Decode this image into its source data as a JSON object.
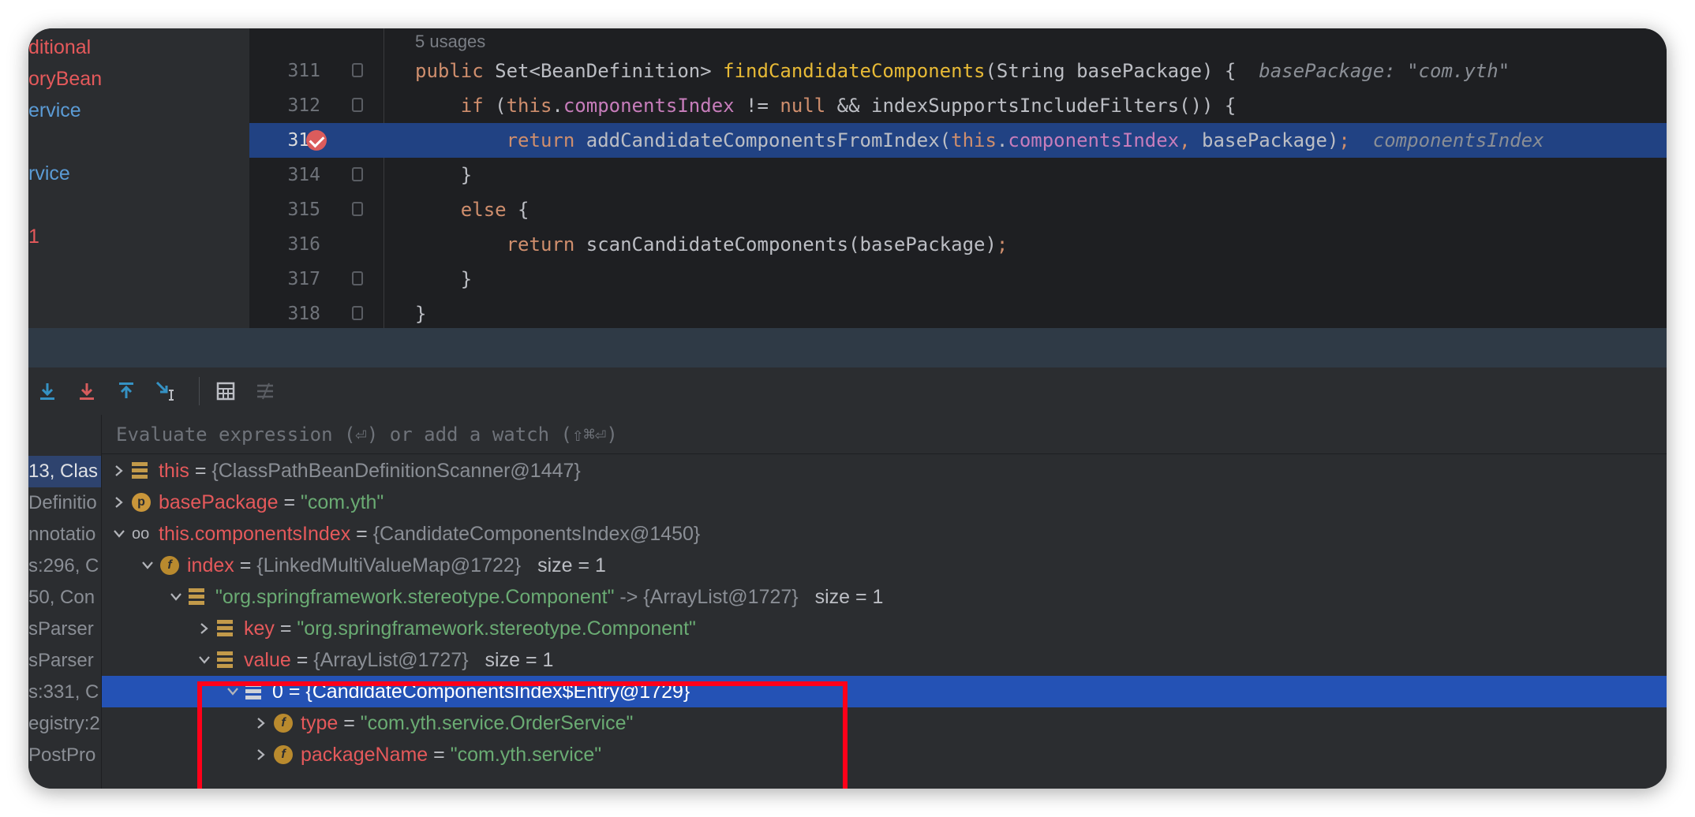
{
  "project_panel": {
    "items": [
      {
        "label": "ditional",
        "color": "red"
      },
      {
        "label": "oryBean",
        "color": "red"
      },
      {
        "label": "ervice",
        "color": "blue"
      },
      {
        "label": "rvice",
        "color": "blue"
      },
      {
        "label": "1",
        "color": "red"
      }
    ]
  },
  "editor": {
    "usages": "5 usages",
    "lines": [
      {
        "no": "311",
        "segments": [
          {
            "t": "public ",
            "c": "kw"
          },
          {
            "t": "Set<BeanDefinition> ",
            "c": ""
          },
          {
            "t": "findCandidateComponents",
            "c": "fnd"
          },
          {
            "t": "(String basePackage) {  ",
            "c": ""
          },
          {
            "t": "basePackage: \"com.yth\"",
            "c": "hint"
          }
        ]
      },
      {
        "no": "312",
        "segments": [
          {
            "t": "    if ",
            "c": "kw"
          },
          {
            "t": "(",
            "c": ""
          },
          {
            "t": "this",
            "c": "kw"
          },
          {
            "t": ".",
            "c": ""
          },
          {
            "t": "componentsIndex",
            "c": "fld"
          },
          {
            "t": " != ",
            "c": ""
          },
          {
            "t": "null",
            "c": "kw"
          },
          {
            "t": " && indexSupportsIncludeFilters()) {",
            "c": ""
          }
        ]
      },
      {
        "no": "313",
        "segments": [
          {
            "t": "        return ",
            "c": "kw"
          },
          {
            "t": "addCandidateComponentsFromIndex(",
            "c": ""
          },
          {
            "t": "this",
            "c": "kw"
          },
          {
            "t": ".",
            "c": ""
          },
          {
            "t": "componentsIndex",
            "c": "fld"
          },
          {
            "t": ", ",
            "c": "kw"
          },
          {
            "t": "basePackage)",
            "c": ""
          },
          {
            "t": ";",
            "c": "kw"
          },
          {
            "t": "  componentsIndex",
            "c": "hint"
          }
        ]
      },
      {
        "no": "314",
        "segments": [
          {
            "t": "    }",
            "c": ""
          }
        ]
      },
      {
        "no": "315",
        "segments": [
          {
            "t": "    else ",
            "c": "kw"
          },
          {
            "t": "{",
            "c": ""
          }
        ]
      },
      {
        "no": "316",
        "segments": [
          {
            "t": "        return ",
            "c": "kw"
          },
          {
            "t": "scanCandidateComponents(basePackage)",
            "c": ""
          },
          {
            "t": ";",
            "c": "kw"
          }
        ]
      },
      {
        "no": "317",
        "segments": [
          {
            "t": "    }",
            "c": ""
          }
        ]
      },
      {
        "no": "318",
        "segments": [
          {
            "t": "}",
            "c": ""
          }
        ]
      }
    ]
  },
  "debug": {
    "eval_placeholder": "Evaluate expression (⏎) or add a watch (⇧⌘⏎)",
    "frames": [
      "13, Clas",
      "Definitio",
      "nnotatio",
      "s:296, C",
      "50, Con",
      "sParser",
      "sParser",
      "s:331, C",
      "egistry:2",
      "PostPro"
    ],
    "variables": [
      {
        "indent": 0,
        "chev": "›",
        "icon": "stack",
        "name": "this",
        "eq": " = ",
        "value": "{ClassPathBeanDefinitionScanner@1447}",
        "vclass": "vval",
        "size": ""
      },
      {
        "indent": 0,
        "chev": "›",
        "icon": "param",
        "name": "basePackage",
        "eq": " = ",
        "value": "\"com.yth\"",
        "vclass": "vstr",
        "size": ""
      },
      {
        "indent": 0,
        "chev": "⌄",
        "icon": "glasses",
        "name": "this.componentsIndex",
        "eq": " = ",
        "value": "{CandidateComponentsIndex@1450}",
        "vclass": "vval",
        "size": ""
      },
      {
        "indent": 1,
        "chev": "⌄",
        "icon": "field",
        "name": "index",
        "eq": " = ",
        "value": "{LinkedMultiValueMap@1722}",
        "vclass": "vval",
        "size": "size = 1"
      },
      {
        "indent": 2,
        "chev": "⌄",
        "icon": "stack",
        "name": "",
        "eq": "",
        "value": "\"org.springframework.stereotype.Component\" -> {ArrayList@1727}",
        "vclass": "mixed",
        "size": "size = 1"
      },
      {
        "indent": 3,
        "chev": "›",
        "icon": "stack",
        "name": "key",
        "eq": " = ",
        "value": "\"org.springframework.stereotype.Component\"",
        "vclass": "vstr",
        "size": ""
      },
      {
        "indent": 3,
        "chev": "⌄",
        "icon": "stack",
        "name": "value",
        "eq": " = ",
        "value": "{ArrayList@1727}",
        "vclass": "vval",
        "size": "size = 1"
      },
      {
        "indent": 4,
        "chev": "⌄",
        "icon": "stackw",
        "name": "0",
        "eq": " = ",
        "value": "{CandidateComponentsIndex$Entry@1729}",
        "vclass": "vval",
        "size": "",
        "selected": true
      },
      {
        "indent": 5,
        "chev": "›",
        "icon": "field",
        "name": "type",
        "eq": " = ",
        "value": "\"com.yth.service.OrderService\"",
        "vclass": "vstr",
        "size": ""
      },
      {
        "indent": 5,
        "chev": "›",
        "icon": "field",
        "name": "packageName",
        "eq": " = ",
        "value": "\"com.yth.service\"",
        "vclass": "vstr",
        "size": ""
      }
    ]
  },
  "colors": {
    "selection": "#2452b5",
    "highlight_line": "#214283",
    "annotation_box": "#ff0019"
  }
}
